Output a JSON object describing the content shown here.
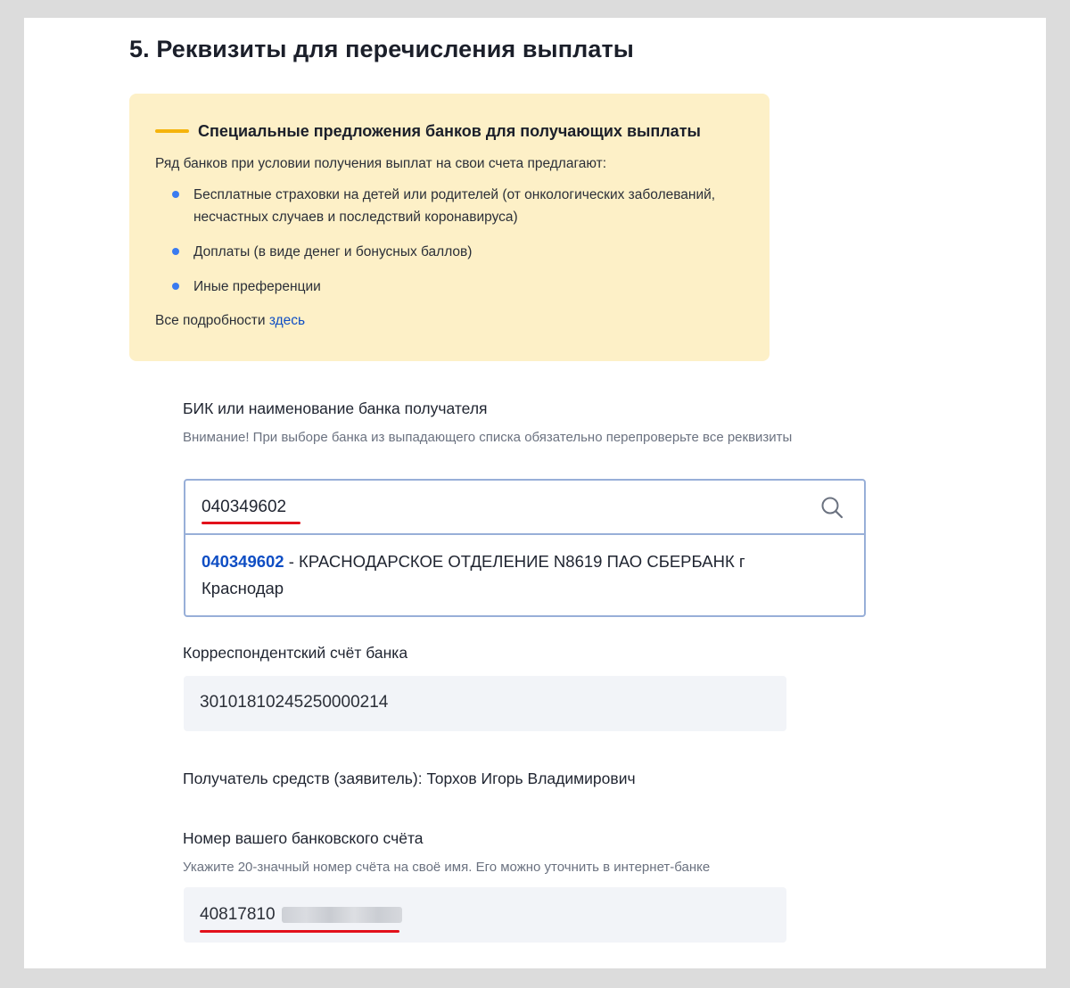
{
  "section": {
    "title": "5. Реквизиты для перечисления выплаты"
  },
  "promo": {
    "title": "Специальные предложения банков для получающих выплаты",
    "intro": "Ряд банков при условии получения выплат на свои счета предлагают:",
    "items": [
      "Бесплатные страховки на детей или родителей (от онкологических заболеваний, несчастных случаев и последствий коронавируса)",
      "Доплаты (в виде денег и бонусных баллов)",
      "Иные преференции"
    ],
    "more_text": "Все подробности",
    "more_link": "здесь"
  },
  "bik": {
    "label": "БИК или наименование банка получателя",
    "hint": "Внимание! При выборе банка из выпадающего списка обязательно перепроверьте все реквизиты",
    "value": "040349602",
    "suggestion_code": "040349602",
    "suggestion_text": " - КРАСНОДАРСКОЕ ОТДЕЛЕНИЕ N8619 ПАО СБЕРБАНК г Краснодар"
  },
  "corr_account": {
    "label": "Корреспондентский счёт банка",
    "value": "30101810245250000214"
  },
  "recipient": {
    "text": "Получатель средств (заявитель): Торхов Игорь Владимирович"
  },
  "account": {
    "label": "Номер вашего банковского счёта",
    "hint": "Укажите 20-значный номер счёта на своё имя. Его можно уточнить в интернет-банке",
    "value_visible": "40817810"
  },
  "colors": {
    "promo_bg": "#fdf0c7",
    "accent_bar": "#f5b40c",
    "link": "#0f4ec4",
    "bullet": "#3a7bf0",
    "annotation_red": "#e2111b",
    "input_border": "#98afd8"
  }
}
